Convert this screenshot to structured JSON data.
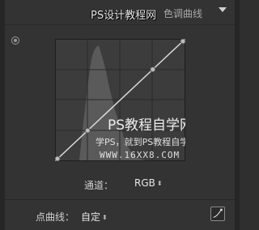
{
  "header": {
    "title": "色调曲线",
    "watermark": "PS设计教程网"
  },
  "overlay": {
    "line1": "PS教程自学网",
    "line2": "学PS，就到PS教程自学网",
    "line3": "WWW.16XX8.COM"
  },
  "channel": {
    "label": "通道：",
    "value": "RGB"
  },
  "point_curve": {
    "label": "点曲线：",
    "value": "自定"
  },
  "curve_points": [
    {
      "input": 0,
      "output": 0
    },
    {
      "input": 25,
      "output": 25
    },
    {
      "input": 75,
      "output": 75
    },
    {
      "input": 100,
      "output": 100
    }
  ],
  "colors": {
    "panel": "#333333",
    "graph_bg": "#3c3c3c",
    "histogram": "#5a5a5a",
    "curve": "#dcdcdc"
  },
  "icons": {
    "collapse": "triangle-down-icon",
    "target": "target-adjustment-icon",
    "stepper": "up-down-arrows-icon",
    "edit_point": "edit-point-curve-icon"
  }
}
